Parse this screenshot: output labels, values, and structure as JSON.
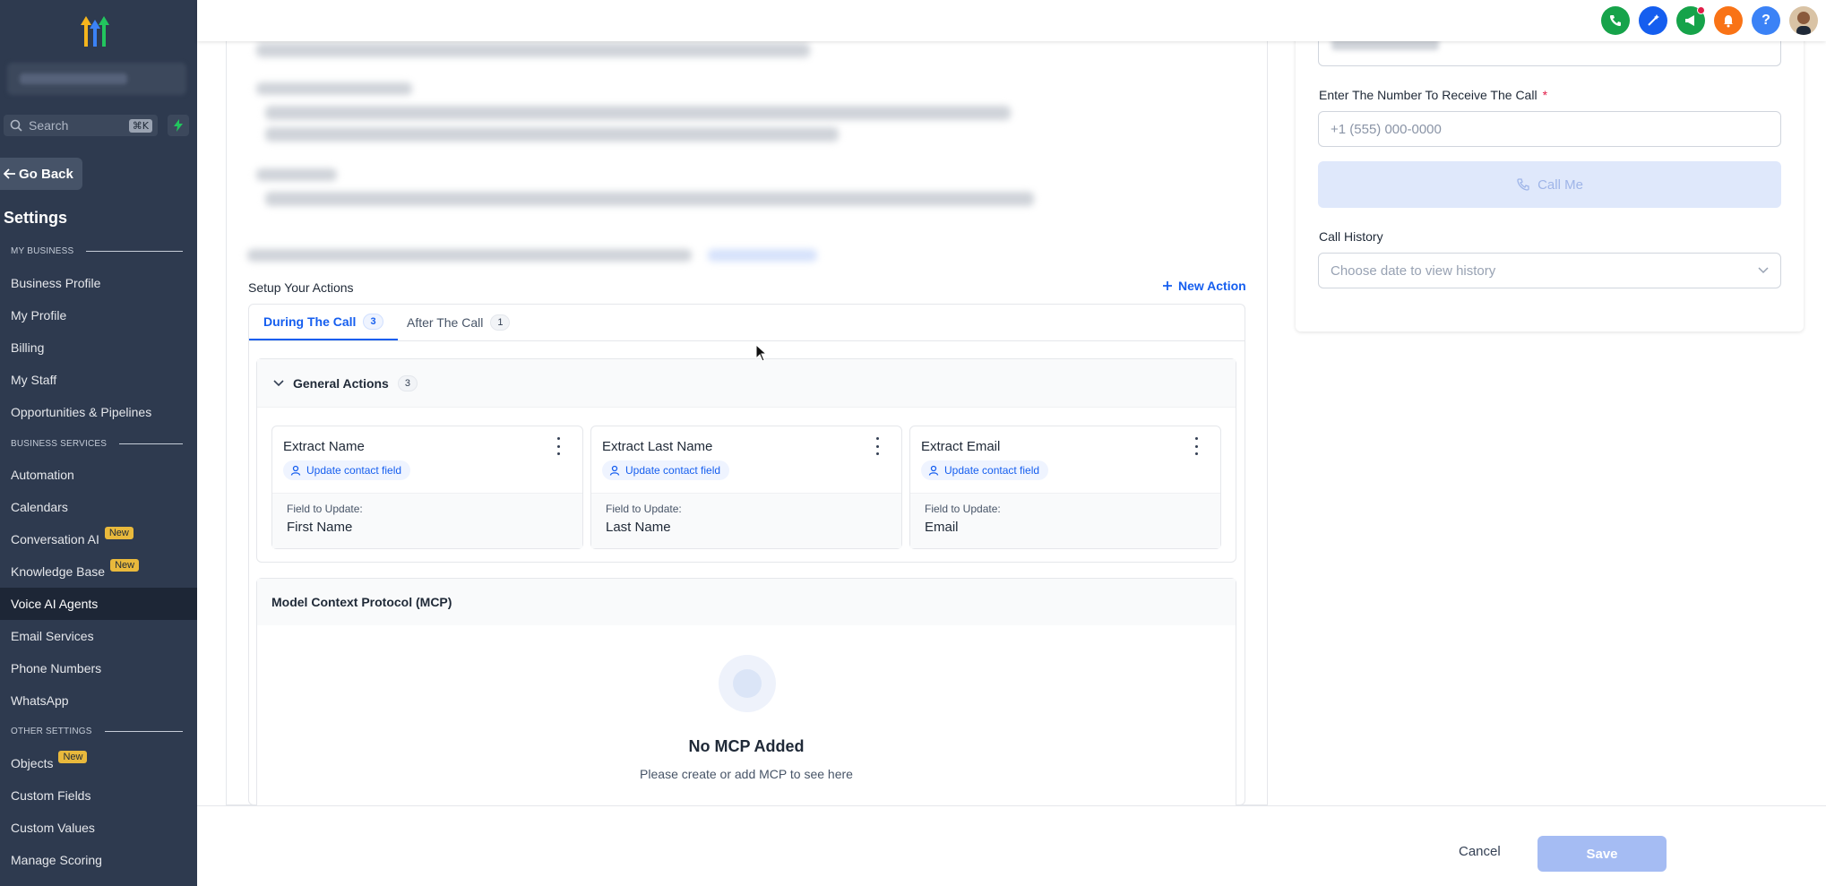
{
  "sidebar": {
    "search_placeholder": "Search",
    "search_shortcut": "⌘K",
    "go_back": "Go Back",
    "title": "Settings",
    "sections": {
      "my_business": "MY BUSINESS",
      "business_services": "BUSINESS SERVICES",
      "other_settings": "OTHER SETTINGS"
    },
    "items": [
      {
        "label": "Business Profile"
      },
      {
        "label": "My Profile"
      },
      {
        "label": "Billing"
      },
      {
        "label": "My Staff"
      },
      {
        "label": "Opportunities & Pipelines"
      },
      {
        "label": "Automation"
      },
      {
        "label": "Calendars"
      },
      {
        "label": "Conversation AI",
        "badge": "New"
      },
      {
        "label": "Knowledge Base",
        "badge": "New"
      },
      {
        "label": "Voice AI Agents",
        "active": true
      },
      {
        "label": "Email Services"
      },
      {
        "label": "Phone Numbers"
      },
      {
        "label": "WhatsApp"
      },
      {
        "label": "Objects",
        "badge": "New"
      },
      {
        "label": "Custom Fields"
      },
      {
        "label": "Custom Values"
      },
      {
        "label": "Manage Scoring"
      }
    ]
  },
  "topbar": {
    "icons": [
      "phone-icon",
      "magic-wand-icon",
      "megaphone-icon",
      "bell-icon",
      "help-icon",
      "avatar"
    ],
    "colors": {
      "phone": "#16a34a",
      "magic": "#155eef",
      "megaphone": "#16a34a",
      "bell": "#f97316",
      "help": "#3b82f6"
    },
    "help_glyph": "?"
  },
  "actions": {
    "setup_label": "Setup Your Actions",
    "new_action": "New Action",
    "tabs": [
      {
        "label": "During The Call",
        "count": "3",
        "active": true
      },
      {
        "label": "After The Call",
        "count": "1",
        "active": false
      }
    ],
    "general": {
      "title": "General Actions",
      "count": "3",
      "cards": [
        {
          "title": "Extract Name",
          "tag": "Update contact field",
          "field_label": "Field to Update:",
          "field_value": "First Name"
        },
        {
          "title": "Extract Last Name",
          "tag": "Update contact field",
          "field_label": "Field to Update:",
          "field_value": "Last Name"
        },
        {
          "title": "Extract Email",
          "tag": "Update contact field",
          "field_label": "Field to Update:",
          "field_value": "Email"
        }
      ]
    },
    "mcp": {
      "title": "Model Context Protocol (MCP)",
      "empty_title": "No MCP Added",
      "empty_sub": "Please create or add MCP to see here"
    }
  },
  "right_panel": {
    "number_label": "Enter The Number To Receive The Call",
    "required_mark": "*",
    "number_placeholder": "+1 (555) 000-0000",
    "call_button": "Call Me",
    "history_label": "Call History",
    "history_placeholder": "Choose date to view history"
  },
  "footer": {
    "cancel": "Cancel",
    "save": "Save"
  },
  "colors": {
    "sidebar_bg": "#2e3a4f",
    "accent": "#155eef",
    "badge_new": "#e9b93c"
  }
}
